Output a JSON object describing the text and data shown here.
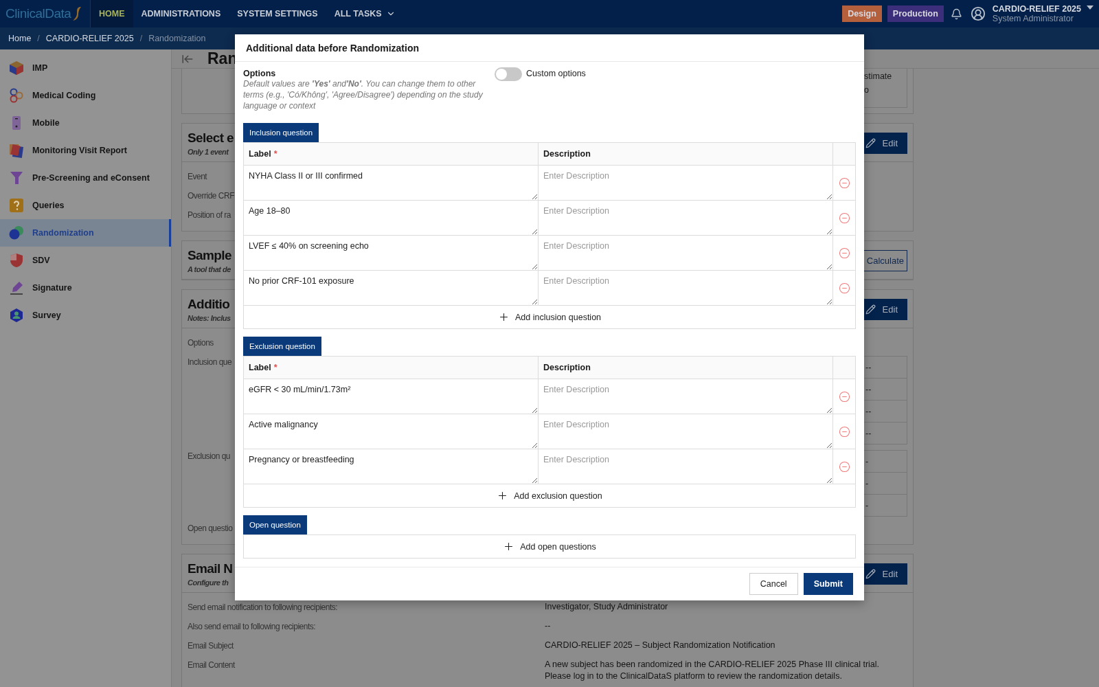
{
  "topbar": {
    "logo": "ClinicalData",
    "nav": [
      {
        "label": "HOME",
        "selected": true,
        "dropdown": false
      },
      {
        "label": "ADMINISTRATIONS",
        "selected": false,
        "dropdown": false
      },
      {
        "label": "SYSTEM SETTINGS",
        "selected": false,
        "dropdown": false
      },
      {
        "label": "ALL TASKS",
        "selected": false,
        "dropdown": true
      }
    ],
    "env_buttons": [
      {
        "label": "Design",
        "color": "#b5603c"
      },
      {
        "label": "Production",
        "color": "#3c2e7a"
      }
    ],
    "study": "CARDIO-RELIEF 2025",
    "role": "System Administrator"
  },
  "breadcrumb": {
    "separator": "/",
    "items": [
      "Home",
      "CARDIO-RELIEF 2025",
      "Randomization"
    ]
  },
  "sidebar": {
    "items": [
      {
        "label": "IMP",
        "selected": false
      },
      {
        "label": "Medical Coding",
        "selected": false
      },
      {
        "label": "Mobile",
        "selected": false
      },
      {
        "label": "Monitoring Visit Report",
        "selected": false
      },
      {
        "label": "Pre-Screening and eConsent",
        "selected": false
      },
      {
        "label": "Queries",
        "selected": false
      },
      {
        "label": "Randomization",
        "selected": true
      },
      {
        "label": "SDV",
        "selected": false
      },
      {
        "label": "Signature",
        "selected": false
      },
      {
        "label": "Survey",
        "selected": false
      }
    ]
  },
  "page": {
    "title": "Ran",
    "cards": [
      {
        "side_lines": [
          "stimate",
          "o"
        ]
      },
      {
        "title": "Select e",
        "subtitle": "Only 1 event",
        "action": {
          "kind": "solid",
          "label": "Edit"
        },
        "rows": [
          {
            "label": "Event"
          },
          {
            "label": "Override CRF"
          },
          {
            "label": "Position of ra"
          }
        ]
      },
      {
        "title": "Sample",
        "subtitle": "A tool that de",
        "action": {
          "kind": "outline",
          "label": "Calculate"
        }
      },
      {
        "title": "Additio",
        "subtitle": "Notes: Inclus",
        "action": {
          "kind": "solid",
          "label": "Edit"
        },
        "rows": [
          {
            "label": "Options"
          },
          {
            "label": "Inclusion que",
            "cells": [
              "--",
              "--",
              "--",
              "--"
            ]
          },
          {
            "label": "Exclusion qu",
            "cells": [
              "-",
              "-",
              "-"
            ]
          },
          {
            "label": "Open questio"
          }
        ]
      },
      {
        "title": "Email N",
        "subtitle": "Configure th",
        "action": {
          "kind": "solid",
          "label": "Edit"
        },
        "rows": [
          {
            "label": "Send email notification to following recipients:",
            "value": "Investigator, Study Administrator"
          },
          {
            "label": "Also send email to following recipients:",
            "value": "--"
          },
          {
            "label": "Email Subject",
            "value": "CARDIO-RELIEF 2025 – Subject Randomization Notification"
          },
          {
            "label": "Email Content",
            "value": "A new subject has been randomized in the CARDIO-RELIEF 2025 Phase III clinical trial. Please log in to the ClinicalDataS platform to review the randomization details."
          }
        ]
      }
    ]
  },
  "modal": {
    "title": "Additional data before Randomization",
    "options": {
      "label": "Options",
      "hint": "Default values are **'Yes'** and**'No'**. You can change them to other terms (e.g., 'Có/Không', 'Agree/Disagree') depending on the study language or context"
    },
    "custom_options": {
      "label": "Custom options",
      "on": false
    },
    "sections": [
      {
        "tab": "Inclusion question",
        "columns": [
          {
            "label": "Label",
            "required_mark": "*"
          },
          {
            "label": "Description"
          }
        ],
        "rows": [
          {
            "label": "NYHA Class II or III confirmed",
            "description_placeholder": "Enter Description"
          },
          {
            "label": "Age 18–80",
            "description_placeholder": "Enter Description"
          },
          {
            "label": "LVEF ≤ 40% on screening echo",
            "description_placeholder": "Enter Description"
          },
          {
            "label": "No prior CRF-101 exposure",
            "description_placeholder": "Enter Description"
          }
        ],
        "add": "Add inclusion question"
      },
      {
        "tab": "Exclusion question",
        "columns": [
          {
            "label": "Label",
            "required_mark": "*"
          },
          {
            "label": "Description"
          }
        ],
        "rows": [
          {
            "label": "eGFR < 30 mL/min/1.73m²",
            "description_placeholder": "Enter Description"
          },
          {
            "label": "Active malignancy",
            "description_placeholder": "Enter Description"
          },
          {
            "label": "Pregnancy or breastfeeding",
            "description_placeholder": "Enter Description"
          }
        ],
        "add": "Add exclusion question"
      },
      {
        "tab": "Open question",
        "add": "Add open questions"
      }
    ],
    "buttons": [
      {
        "kind": "secondary",
        "label": "Cancel"
      },
      {
        "kind": "primary",
        "label": "Submit"
      }
    ]
  }
}
